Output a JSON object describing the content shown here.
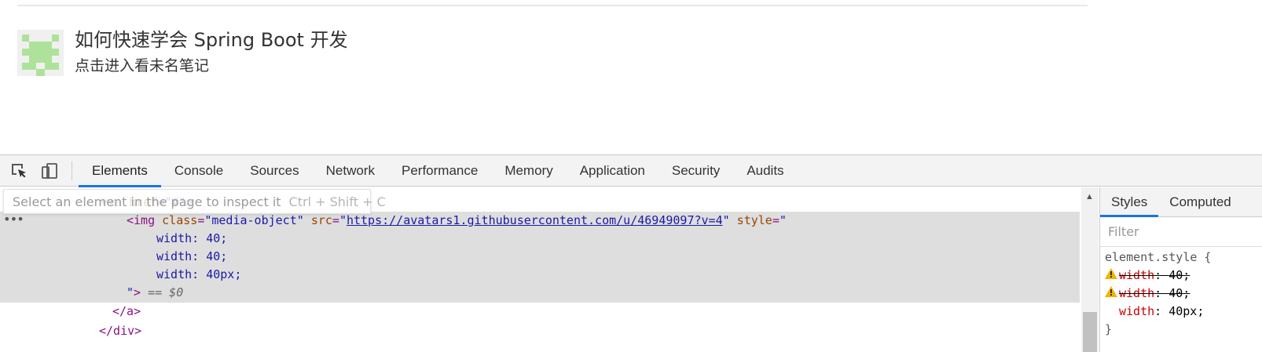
{
  "page": {
    "title": "如何快速学会 Spring Boot 开发",
    "subtitle": "点击进入看未名笔记"
  },
  "devtools": {
    "tabs": [
      "Elements",
      "Console",
      "Sources",
      "Network",
      "Performance",
      "Memory",
      "Application",
      "Security",
      "Audits"
    ],
    "active_tab": "Elements",
    "tooltip": {
      "text": "Select an element in the page to inspect it",
      "shortcut": "Ctrl + Shift + C"
    },
    "dom": {
      "a_open": {
        "tag": "a",
        "attr": "href",
        "value": "#"
      },
      "img": {
        "tag": "img",
        "class_attr": "class",
        "class_val": "media-object",
        "src_attr": "src",
        "src_val": "https://avatars1.githubusercontent.com/u/46949097?v=4",
        "style_attr": "style",
        "style_lines": [
          "width: 40;",
          "width: 40;",
          "width: 40px;"
        ],
        "selected_marker": "== $0"
      },
      "a_close": "</a>",
      "div_close": "</div>"
    },
    "styles_panel": {
      "tabs": [
        "Styles",
        "Computed"
      ],
      "filter_placeholder": "Filter",
      "selector": "element.style {",
      "props": [
        {
          "name": "width",
          "value": "40;",
          "warning": true,
          "struck": true
        },
        {
          "name": "width",
          "value": "40;",
          "warning": true,
          "struck": true
        },
        {
          "name": "width",
          "value": "40px;",
          "warning": false,
          "struck": false
        }
      ],
      "close_brace": "}"
    }
  },
  "colors": {
    "accent": "#1a73e8",
    "avatar_green": "#aee29b",
    "selection_bg": "#dedede"
  }
}
